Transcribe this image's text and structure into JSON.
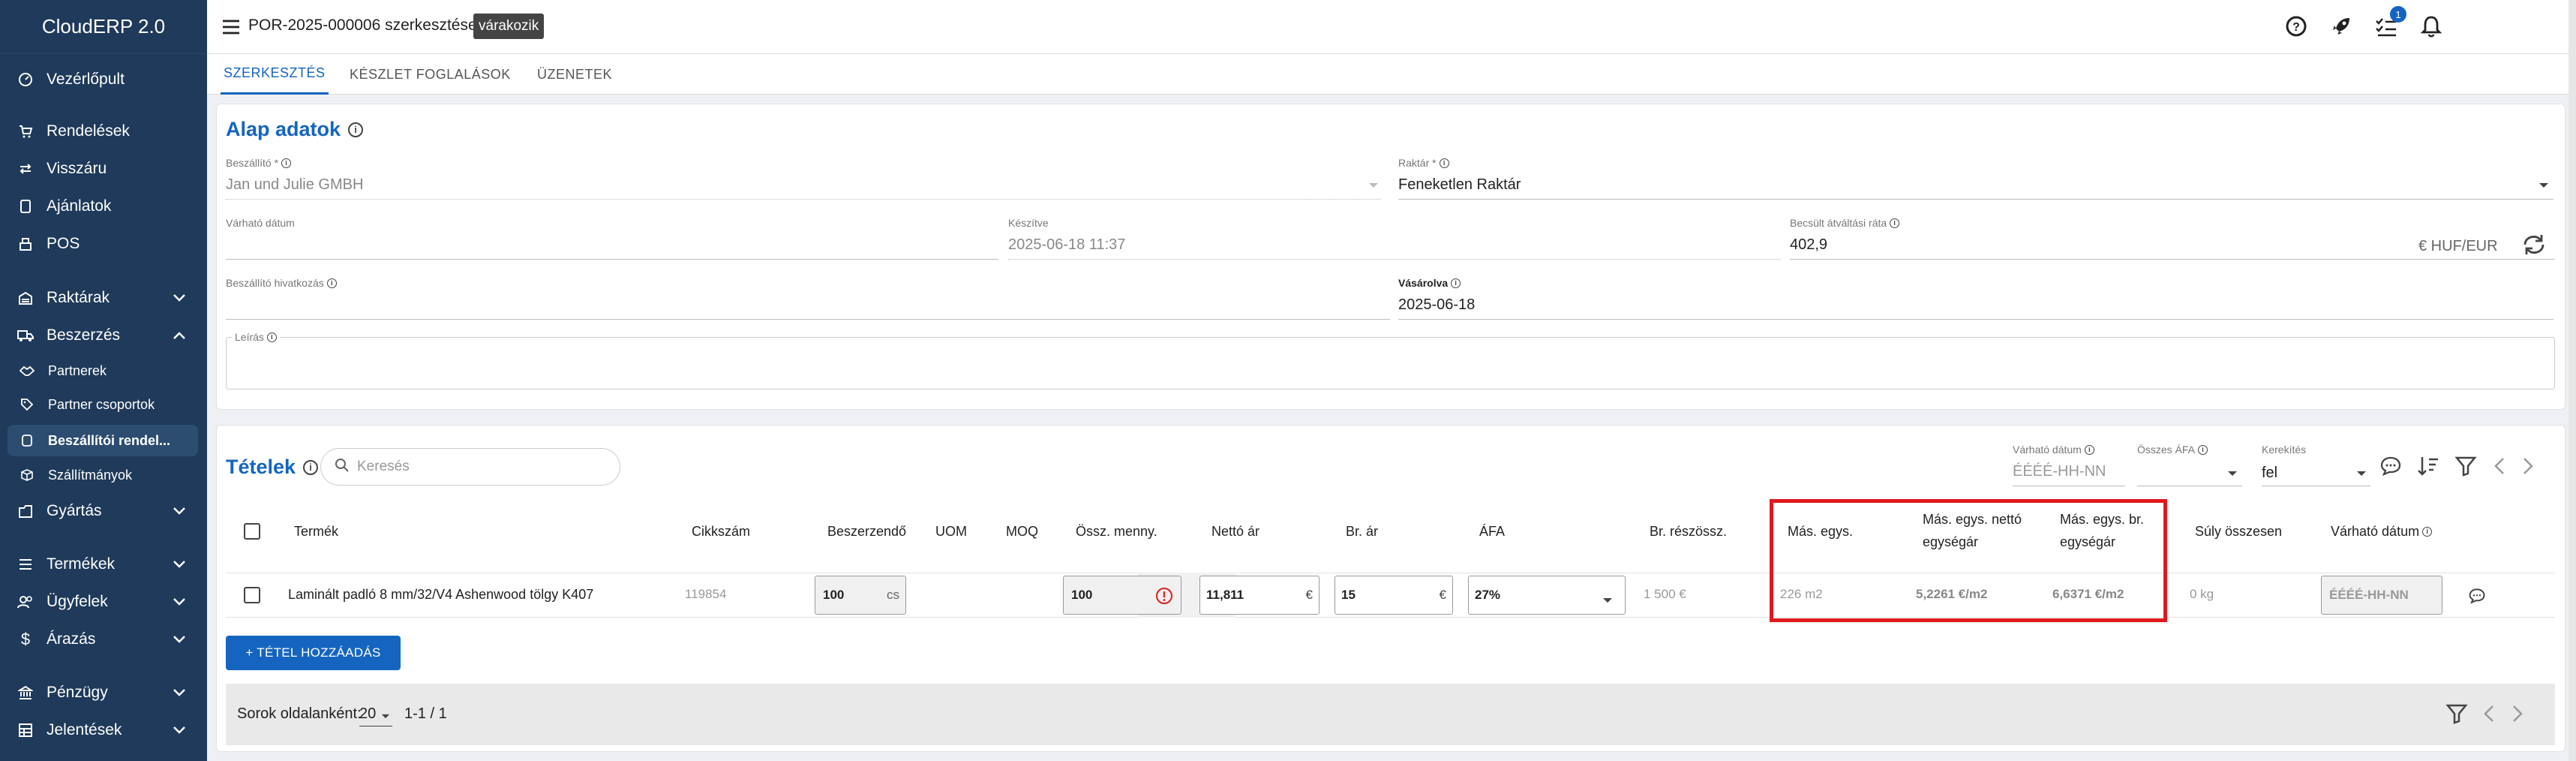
{
  "app": {
    "title": "CloudERP 2.0"
  },
  "sidebar": {
    "items": [
      {
        "label": "Vezérlőpult",
        "icon": "dashboard-icon"
      },
      {
        "label": "Rendelések",
        "icon": "cart-icon"
      },
      {
        "label": "Visszáru",
        "icon": "swap-icon"
      },
      {
        "label": "Ajánlatok",
        "icon": "document-icon"
      },
      {
        "label": "POS",
        "icon": "pos-icon"
      },
      {
        "label": "Raktárak",
        "icon": "warehouse-icon"
      },
      {
        "label": "Beszerzés",
        "icon": "truck-icon"
      },
      {
        "label": "Partnerek",
        "icon": "handshake-icon"
      },
      {
        "label": "Partner csoportok",
        "icon": "tag-icon"
      },
      {
        "label": "Beszállítói rendel...",
        "icon": "order-icon"
      },
      {
        "label": "Szállítmányok",
        "icon": "shipment-icon"
      },
      {
        "label": "Gyártás",
        "icon": "factory-icon"
      },
      {
        "label": "Termékek",
        "icon": "products-icon"
      },
      {
        "label": "Ügyfelek",
        "icon": "users-icon"
      },
      {
        "label": "Árazás",
        "icon": "dollar-icon"
      },
      {
        "label": "Pénzügy",
        "icon": "bank-icon"
      },
      {
        "label": "Jelentések",
        "icon": "table-icon"
      }
    ]
  },
  "header": {
    "title": "POR-2025-000006 szerkesztése",
    "status": "várakozik",
    "notif_count": "1"
  },
  "tabs": [
    {
      "label": "SZERKESZTÉS"
    },
    {
      "label": "KÉSZLET FOGLALÁSOK"
    },
    {
      "label": "ÜZENETEK"
    }
  ],
  "basic": {
    "title": "Alap adatok",
    "supplier_label": "Beszállító *",
    "supplier_value": "Jan und Julie GMBH",
    "warehouse_label": "Raktár *",
    "warehouse_value": "Feneketlen Raktár",
    "expected_label": "Várható dátum",
    "created_label": "Készítve",
    "created_value": "2025-06-18 11:37",
    "rate_label": "Becsült átváltási ráta",
    "rate_value": "402,9",
    "rate_unit": "€ HUF/EUR",
    "ref_label": "Beszállító hivatkozás",
    "bought_label": "Vásárolva",
    "bought_value": "2025-06-18",
    "desc_label": "Leírás"
  },
  "items": {
    "title": "Tételek",
    "search_placeholder": "Keresés",
    "expected_label": "Várható dátum",
    "expected_placeholder": "ÉÉÉÉ-HH-NN",
    "vat_label": "Összes ÁFA",
    "round_label": "Kerekítés",
    "round_value": "fel",
    "columns": {
      "product": "Termék",
      "sku": "Cikkszám",
      "order_qty": "Beszerzendő",
      "uom": "UOM",
      "moq": "MOQ",
      "total_qty": "Össz. menny.",
      "net_price": "Nettó ár",
      "gross_price": "Br. ár",
      "vat": "ÁFA",
      "gross_subtotal": "Br. részössz.",
      "alt_unit": "Más. egys.",
      "alt_net": "Más. egys. nettó egységár",
      "alt_gross": "Más. egys. br. egységár",
      "weight": "Súly összesen",
      "expected": "Várható dátum"
    },
    "row": {
      "product": "Laminált padló 8 mm/32/V4 Ashenwood tölgy K407",
      "sku": "119854",
      "order_qty": "100",
      "order_unit": "cs",
      "total_qty": "100",
      "net_price": "11,811",
      "net_cur": "€",
      "gross_price": "15",
      "gross_cur": "€",
      "vat": "27%",
      "gross_subtotal": "1 500 €",
      "alt_unit": "226 m2",
      "alt_net": "5,2261 €/m2",
      "alt_gross": "6,6371 €/m2",
      "weight": "0 kg",
      "expected_placeholder": "ÉÉÉÉ-HH-NN"
    },
    "add_button": "+ TÉTEL HOZZÁADÁS",
    "rows_per_page_label": "Sorok oldalanként:",
    "rows_per_page": "20",
    "page_info": "1-1 / 1"
  },
  "colors": {
    "sidebar": "#1f3a5a",
    "accent": "#1565c0",
    "highlight": "#e0191f"
  }
}
